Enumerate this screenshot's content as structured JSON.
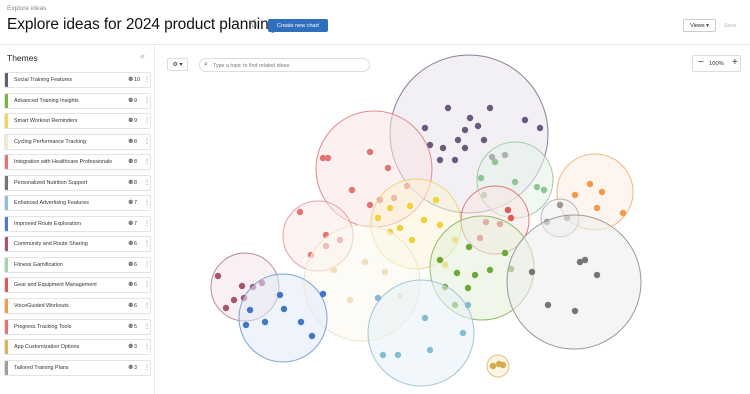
{
  "header": {
    "breadcrumb": "Explore ideas",
    "title": "Explore ideas for 2024 product planning",
    "create_label": "Create new chart",
    "views_label": "Views ▾",
    "save_label": "Save"
  },
  "sidebar": {
    "title": "Themes",
    "collapse_glyph": "«",
    "themes": [
      {
        "label": "Social Training Features",
        "count": "10",
        "color": "#6b5b7b"
      },
      {
        "label": "Advanced Training Insights",
        "count": "9",
        "color": "#7cb342"
      },
      {
        "label": "Smart Workout Reminders",
        "count": "9",
        "color": "#f2d45c"
      },
      {
        "label": "Cycling Performance Tracking",
        "count": "8",
        "color": "#f3ead0"
      },
      {
        "label": "Integration with Healthcare Professionals",
        "count": "8",
        "color": "#e57373"
      },
      {
        "label": "Personalized Nutrition Support",
        "count": "8",
        "color": "#757575"
      },
      {
        "label": "Enhanced Advertising Features",
        "count": "7",
        "color": "#8ec1d6"
      },
      {
        "label": "Improved Route Exploration",
        "count": "7",
        "color": "#4a7ec8"
      },
      {
        "label": "Community and Route Sharing",
        "count": "6",
        "color": "#a8556b"
      },
      {
        "label": "Fitness Gamification",
        "count": "6",
        "color": "#a5d6a7"
      },
      {
        "label": "Gear and Equipment Management",
        "count": "6",
        "color": "#e05a5a"
      },
      {
        "label": "VoiceGuided Workouts",
        "count": "6",
        "color": "#f29a4a"
      },
      {
        "label": "Progress Tracking Tools",
        "count": "5",
        "color": "#e57373"
      },
      {
        "label": "App Customization Options",
        "count": "3",
        "color": "#e0b35a"
      },
      {
        "label": "Tailored Training Plans",
        "count": "3",
        "color": "#9e9e9e"
      }
    ]
  },
  "toolbar": {
    "settings_label": "⚙ ▾",
    "search_icon": "⌕",
    "search_placeholder": "Type a topic to find related ideas",
    "zoom_minus": "−",
    "zoom_value": "100%",
    "zoom_plus": "+"
  },
  "bubbles": [
    {
      "theme": "Social Training Features",
      "stroke": "#8a7f96",
      "fill": "#e7e2ec",
      "dot": "#6b5b7b"
    },
    {
      "theme": "Integration with Healthcare Professionals",
      "stroke": "#e08a8a",
      "fill": "#f9e4e4",
      "dot": "#e07474"
    },
    {
      "theme": "Smart Workout Reminders",
      "stroke": "#e9d37a",
      "fill": "#fbf3d4",
      "dot": "#f2d13c"
    },
    {
      "theme": "Fitness Gamification",
      "stroke": "#9cc99e",
      "fill": "#e6f2e7",
      "dot": "#8fc493"
    },
    {
      "theme": "VoiceGuided Workouts",
      "stroke": "#f0b37a",
      "fill": "#fdeee0",
      "dot": "#f29a4a"
    },
    {
      "theme": "Tailored Training Plans",
      "stroke": "#b5b5b5",
      "fill": "#eeeeee",
      "dot": "#999999"
    },
    {
      "theme": "Gear and Equipment Management",
      "stroke": "#e07a7a",
      "fill": "#fbe3e3",
      "dot": "#e05a5a"
    },
    {
      "theme": "Progress Tracking Tools",
      "stroke": "#e8a0a0",
      "fill": "#fbe9e9",
      "dot": "#e57373"
    },
    {
      "theme": "Cycling Performance Tracking",
      "stroke": "#efe4c8",
      "fill": "#fbf7ec",
      "dot": "#efe0b8"
    },
    {
      "theme": "Advanced Training Insights",
      "stroke": "#8fbf6a",
      "fill": "#e4f1d8",
      "dot": "#6aa837"
    },
    {
      "theme": "Personalized Nutrition Support",
      "stroke": "#9a9a9a",
      "fill": "#ececec",
      "dot": "#757575"
    },
    {
      "theme": "Community and Route Sharing",
      "stroke": "#b98a98",
      "fill": "#f3e4e8",
      "dot": "#a8556b"
    },
    {
      "theme": "Improved Route Exploration",
      "stroke": "#7ea1d6",
      "fill": "#e1eaf7",
      "dot": "#3f76c6"
    },
    {
      "theme": "Enhanced Advertising Features",
      "stroke": "#9fc5d6",
      "fill": "#e6f1f6",
      "dot": "#86bcd2"
    },
    {
      "theme": "App Customization Options",
      "stroke": "#e0c27a",
      "fill": "#f8edd0",
      "dot": "#d6ac4a"
    }
  ]
}
